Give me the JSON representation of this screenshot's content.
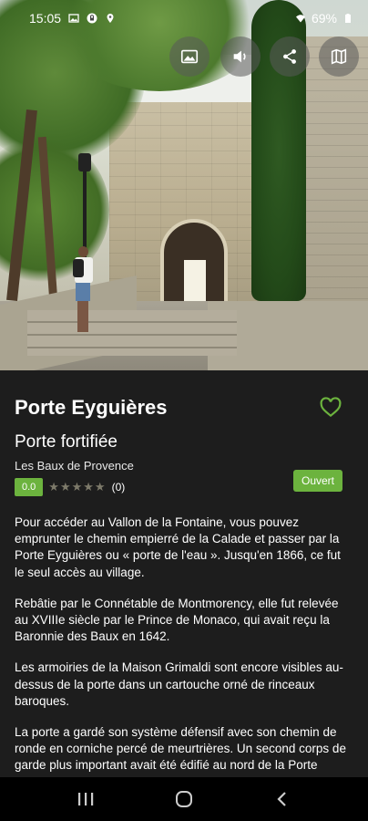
{
  "status_bar": {
    "time": "15:05",
    "battery": "69%",
    "icons": [
      "image-icon",
      "lock-icon",
      "location-icon",
      "wifi-icon",
      "battery-icon"
    ]
  },
  "hero": {
    "actions": [
      {
        "icon": "gallery-icon"
      },
      {
        "icon": "audio-icon"
      },
      {
        "icon": "share-icon"
      },
      {
        "icon": "map-icon"
      }
    ]
  },
  "place": {
    "title": "Porte Eyguières",
    "type": "Porte fortifiée",
    "location": "Les Baux de Provence",
    "score": "0.0",
    "stars": "★★★★★",
    "review_count": "(0)",
    "status": "Ouvert"
  },
  "description": [
    "Pour accéder au Vallon de la Fontaine, vous pouvez emprunter le chemin empierré de la Calade et passer par la Porte Eyguières ou « porte de l'eau ». Jusqu'en 1866, ce fut le seul accès au village.",
    "Rebâtie par le Connétable de Montmorency, elle fut relevée au XVIIIe siècle par le Prince de Monaco, qui avait reçu la Baronnie des Baux en 1642.",
    "Les armoiries de la Maison Grimaldi sont encore visibles au-dessus de la porte dans un cartouche orné de rinceaux baroques.",
    "La porte a gardé son système défensif avec son chemin de ronde en corniche percé de meurtrières. Un second corps de garde plus important avait été édifié au nord de la Porte Eyguières. Il abrite aujourd'hui le Musée des"
  ],
  "colors": {
    "accent": "#6cb33e",
    "background": "#1d1d1d",
    "heart": "#6cb33e"
  }
}
